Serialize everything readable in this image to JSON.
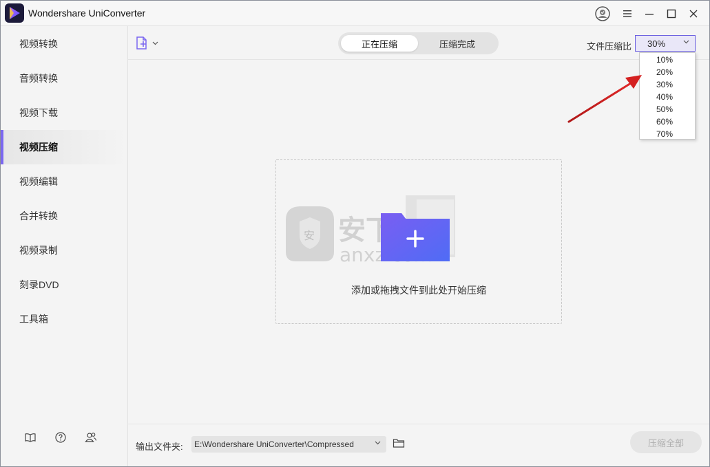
{
  "window": {
    "title": "Wondershare UniConverter"
  },
  "sidebar": {
    "items": [
      {
        "label": "视频转换"
      },
      {
        "label": "音频转换"
      },
      {
        "label": "视频下载"
      },
      {
        "label": "视频压缩",
        "active": true
      },
      {
        "label": "视频编辑"
      },
      {
        "label": "合并转换"
      },
      {
        "label": "视频录制"
      },
      {
        "label": "刻录DVD"
      },
      {
        "label": "工具箱"
      }
    ],
    "bottom_icons": [
      "book-icon",
      "help-icon",
      "users-icon"
    ]
  },
  "toolbar": {
    "tabs": [
      {
        "label": "正在压缩",
        "active": true
      },
      {
        "label": "压缩完成",
        "active": false
      }
    ],
    "ratio_label": "文件压缩比",
    "ratio_value": "30%",
    "ratio_options": [
      "10%",
      "20%",
      "30%",
      "40%",
      "50%",
      "60%",
      "70%"
    ]
  },
  "dropzone": {
    "hint": "添加或拖拽文件到此处开始压缩",
    "watermark": "安下载 anxz.com"
  },
  "bottombar": {
    "output_label": "输出文件夹:",
    "output_path": "E:\\Wondershare UniConverter\\Compressed",
    "compress_all_label": "压缩全部"
  },
  "colors": {
    "accent": "#7b67f0",
    "annotation_arrow": "#d42020"
  }
}
